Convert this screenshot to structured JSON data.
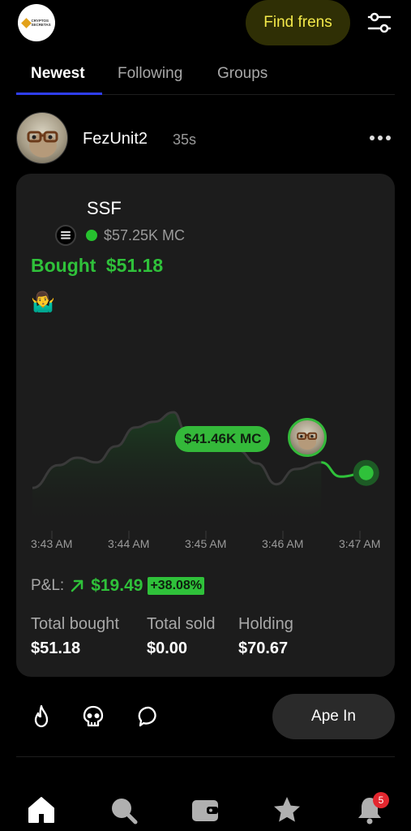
{
  "app": {
    "logo_text": "CRYPTOS SECRETAS",
    "find_frens_label": "Find frens",
    "accent_color": "#2fc13a",
    "icon_names": [
      "filter-icon",
      "more-icon",
      "fire-icon",
      "skull-icon",
      "comment-icon",
      "home-icon",
      "search-icon",
      "wallet-icon",
      "star-icon",
      "bell-icon"
    ]
  },
  "tabs": [
    {
      "label": "Newest",
      "active": true
    },
    {
      "label": "Following",
      "active": false
    },
    {
      "label": "Groups",
      "active": false
    }
  ],
  "post": {
    "username": "FezUnit2",
    "time": "35s",
    "token": {
      "name": "SSF",
      "market_cap": "$57.25K MC",
      "action": "Bought",
      "amount": "$51.18",
      "emoji": "🤷‍♂️"
    },
    "chart_data": {
      "type": "line",
      "title": "",
      "x_ticks": [
        "3:43 AM",
        "3:44 AM",
        "3:45 AM",
        "3:46 AM",
        "3:47 AM"
      ],
      "current_label": "$41.46K MC",
      "points": [
        [
          "3:43:00",
          28
        ],
        [
          "3:43:20",
          52
        ],
        [
          "3:43:35",
          60
        ],
        [
          "3:43:50",
          55
        ],
        [
          "3:44:05",
          72
        ],
        [
          "3:44:20",
          92
        ],
        [
          "3:44:35",
          98
        ],
        [
          "3:44:50",
          108
        ],
        [
          "3:45:00",
          86
        ],
        [
          "3:45:15",
          74
        ],
        [
          "3:45:25",
          82
        ],
        [
          "3:45:40",
          68
        ],
        [
          "3:45:55",
          54
        ],
        [
          "3:46:10",
          32
        ],
        [
          "3:46:25",
          48
        ],
        [
          "3:46:45",
          55
        ],
        [
          "3:47:00",
          40
        ],
        [
          "3:47:20",
          44
        ]
      ],
      "y_range": [
        0,
        120
      ],
      "grid": false
    },
    "pnl": {
      "label": "P&L:",
      "value": "$19.49",
      "percent": "+38.08%"
    },
    "stats": [
      {
        "label": "Total bought",
        "value": "$51.18"
      },
      {
        "label": "Total sold",
        "value": "$0.00"
      },
      {
        "label": "Holding",
        "value": "$70.67"
      }
    ],
    "ape_in_label": "Ape In"
  },
  "nav": {
    "notification_count": "5"
  }
}
